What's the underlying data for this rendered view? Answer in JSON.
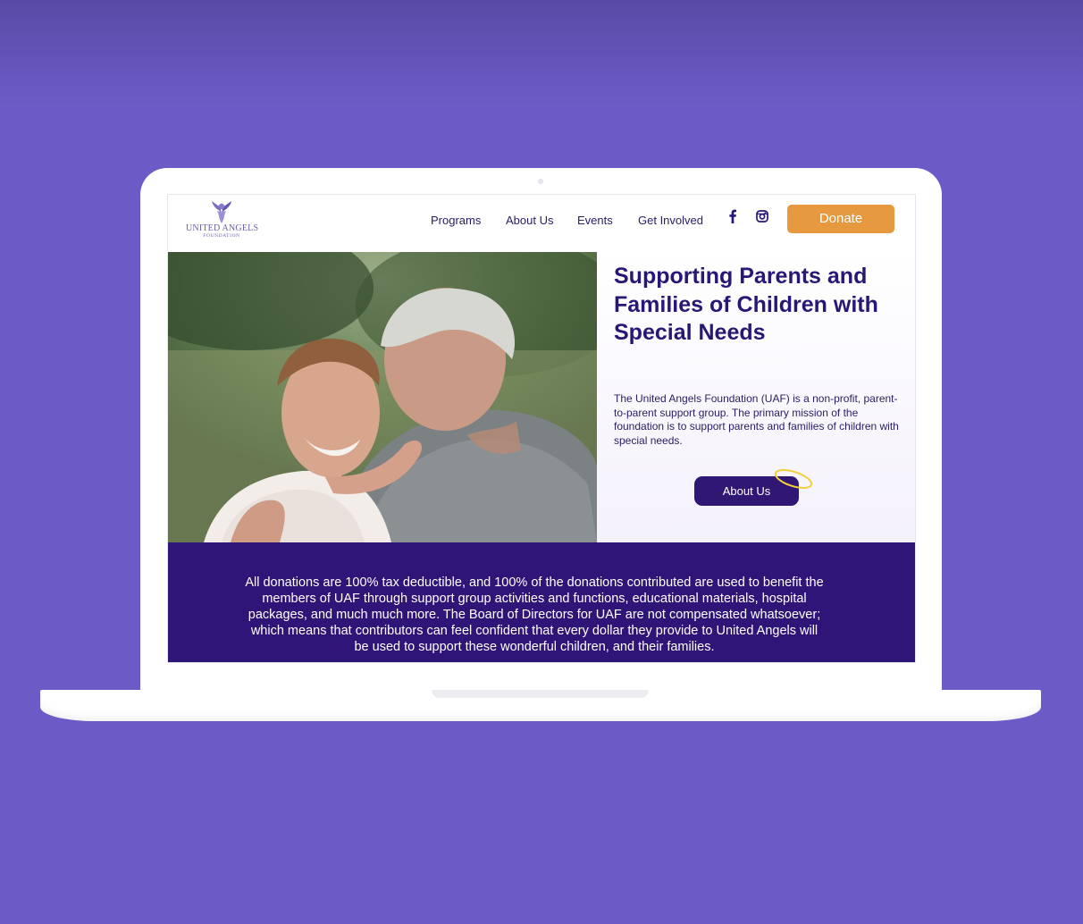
{
  "logo": {
    "name": "UNITED ANGELS",
    "subtitle": "FOUNDATION"
  },
  "nav": {
    "items": [
      {
        "label": "Programs"
      },
      {
        "label": "About Us"
      },
      {
        "label": "Events"
      },
      {
        "label": "Get Involved"
      }
    ],
    "social": [
      "facebook-icon",
      "instagram-icon"
    ],
    "donate_label": "Donate"
  },
  "hero": {
    "title": "Supporting Parents and Families of Children with Special Needs",
    "description": "The United Angels Foundation (UAF) is a non-profit, parent-to-parent support group. The primary mission of the foundation is to support parents and families of children with special needs.",
    "cta_label": "About Us"
  },
  "donation": {
    "text": "All donations are 100% tax deductible, and 100% of the donations contributed are used to benefit the members of UAF through support group activities and functions, educational materials, hospital packages, and much much more. The Board of Directors for UAF are not compensated whatsoever; which means that contributors can feel confident that every dollar they provide to United Angels will be used to support these wonderful children, and their families."
  },
  "colors": {
    "background": "#6c5bc6",
    "brand_purple": "#2e1577",
    "title_purple": "#2a1677",
    "donate_orange": "#e6993e",
    "halo_yellow": "#f2cf3c"
  }
}
